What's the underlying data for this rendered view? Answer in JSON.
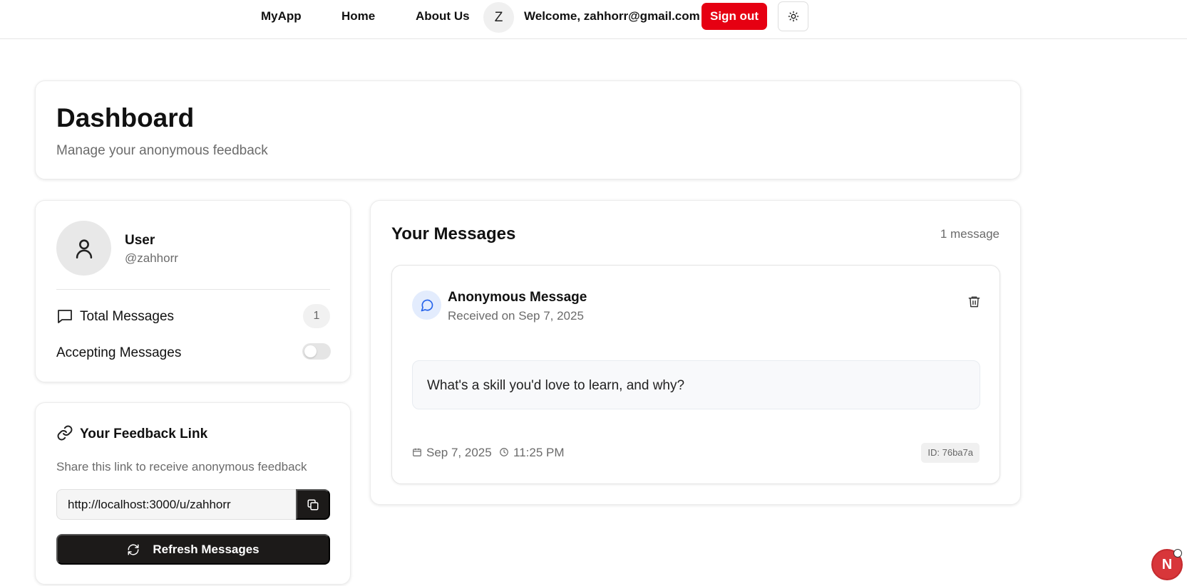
{
  "nav": {
    "brand": "MyApp",
    "home": "Home",
    "about": "About Us",
    "avatar_initial": "Z",
    "welcome": "Welcome, zahhorr@gmail.com",
    "signout": "Sign out",
    "theme_icon": "sun-icon"
  },
  "header": {
    "title": "Dashboard",
    "subtitle": "Manage your anonymous feedback"
  },
  "profile": {
    "name": "User",
    "handle": "@zahhorr",
    "total_messages_label": "Total Messages",
    "total_messages_count": "1",
    "accepting_label": "Accepting Messages",
    "accepting_on": false
  },
  "feedback_link": {
    "title": "Your Feedback Link",
    "description": "Share this link to receive anonymous feedback",
    "url": "http://localhost:3000/u/zahhorr",
    "refresh_label": "Refresh Messages"
  },
  "messages": {
    "title": "Your Messages",
    "count_label": "1 message",
    "items": [
      {
        "title": "Anonymous Message",
        "received": "Received on Sep 7, 2025",
        "body": "What's a skill you'd love to learn, and why?",
        "date": "Sep 7, 2025",
        "time": "11:25 PM",
        "id": "ID: 76ba7a"
      }
    ]
  },
  "dev_badge": "N",
  "colors": {
    "signout": "#e60012",
    "dark_button": "#1c1a19",
    "message_icon_bg": "#e3ecfd",
    "message_icon": "#2563eb"
  }
}
